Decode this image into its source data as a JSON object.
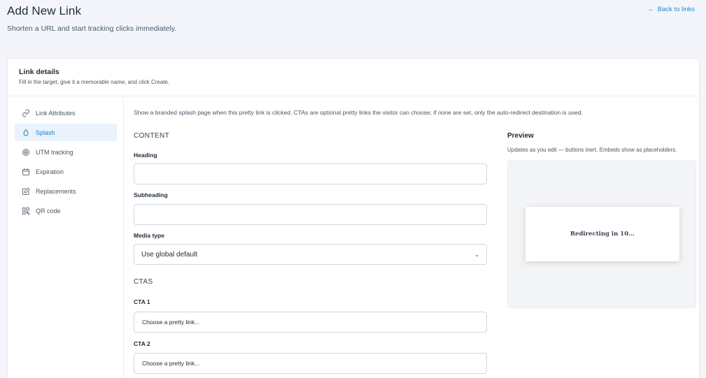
{
  "page": {
    "title": "Add New Link",
    "subtitle": "Shorten a URL and start tracking clicks immediately.",
    "back_link": "Back to links"
  },
  "card": {
    "title": "Link details",
    "description": "Fill in the target, give it a memorable name, and click Create."
  },
  "sidebar": {
    "items": [
      {
        "label": "Link Attributes",
        "icon": "link-icon",
        "active": false
      },
      {
        "label": "Splash",
        "icon": "droplet-icon",
        "active": true
      },
      {
        "label": "UTM tracking",
        "icon": "target-icon",
        "active": false
      },
      {
        "label": "Expiration",
        "icon": "calendar-icon",
        "active": false
      },
      {
        "label": "Replacements",
        "icon": "edit-icon",
        "active": false
      },
      {
        "label": "QR code",
        "icon": "qr-code-icon",
        "active": false
      }
    ]
  },
  "splash": {
    "intro": "Show a branded splash page when this pretty link is clicked. CTAs are optional pretty links the visitor can choose; if none are set, only the auto-redirect destination is used.",
    "content_title": "CONTENT",
    "heading_label": "Heading",
    "heading_value": "",
    "subheading_label": "Subheading",
    "subheading_value": "",
    "media_type_label": "Media type",
    "media_type_value": "Use global default",
    "ctas_title": "CTAS",
    "cta1_label": "CTA 1",
    "cta1_placeholder": "Choose a pretty link...",
    "cta2_label": "CTA 2",
    "cta2_placeholder": "Choose a pretty link..."
  },
  "preview": {
    "title": "Preview",
    "description": "Updates as you edit — buttons inert. Embeds show as placeholders.",
    "redirect_text": "Redirecting in 10..."
  },
  "colors": {
    "accent": "#1e8ccf",
    "active_bg": "#eaf3fc",
    "page_bg": "#f3f5fa"
  }
}
